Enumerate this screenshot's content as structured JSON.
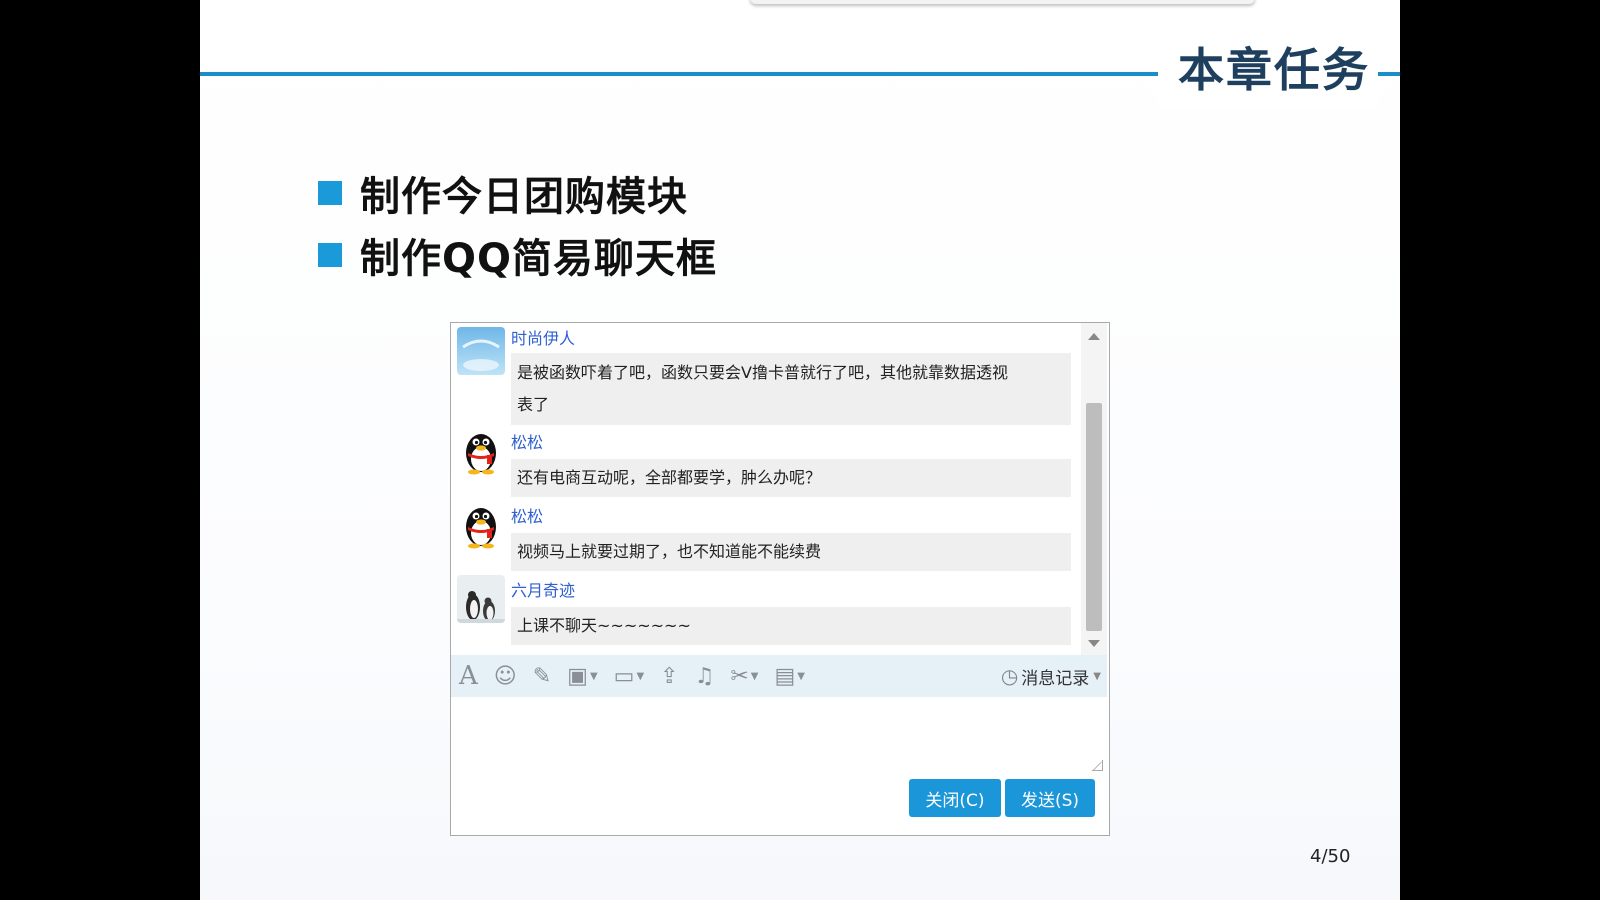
{
  "slide": {
    "title": "本章任务",
    "bullets": [
      "制作今日团购模块",
      "制作QQ简易聊天框"
    ],
    "page_number": "4/50"
  },
  "chat": {
    "messages": [
      {
        "sender": "时尚伊人",
        "avatar": "sky-avatar",
        "lines": [
          "是被函数吓着了吧，函数只要会V撸卡普就行了吧，其他就靠数据透视",
          "表了"
        ]
      },
      {
        "sender": "松松",
        "avatar": "qq-penguin-avatar",
        "lines": [
          "还有电商互动呢，全部都要学，肿么办呢？"
        ]
      },
      {
        "sender": "松松",
        "avatar": "qq-penguin-avatar",
        "lines": [
          "视频马上就要过期了，也不知道能不能续费"
        ]
      },
      {
        "sender": "六月奇迹",
        "avatar": "penguins-photo-avatar",
        "lines": [
          "上课不聊天~~~~~~~"
        ]
      }
    ],
    "toolbar": {
      "icons": [
        "font-icon",
        "emoji-icon",
        "magic-icon",
        "screenshot-icon",
        "image-icon",
        "upload-icon",
        "music-icon",
        "scissors-icon",
        "more-icon"
      ],
      "history_label": "消息记录"
    },
    "buttons": {
      "close_label": "关闭(C)",
      "send_label": "发送(S)"
    }
  },
  "colors": {
    "accent": "#1a9ad8",
    "header_line": "#1a8fc7",
    "title": "#1e3f5e",
    "sender": "#2f5fd0"
  }
}
